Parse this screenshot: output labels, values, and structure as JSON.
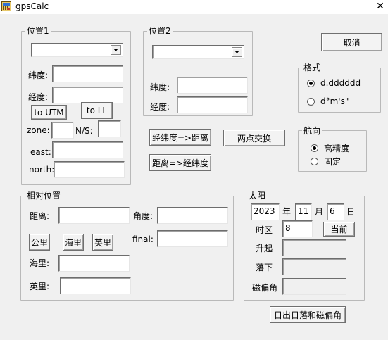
{
  "window": {
    "title": "gpsCalc",
    "close_glyph": "✕",
    "icon": "app-icon"
  },
  "pos1": {
    "legend": "位置1",
    "combo_value": "",
    "lat_label": "纬度:",
    "lat_value": "",
    "lon_label": "经度:",
    "lon_value": "",
    "to_utm_label": "to UTM",
    "to_ll_label": "to LL",
    "zone_label": "zone:",
    "zone_value": "",
    "ns_label": "N/S:",
    "ns_value": "",
    "east_label": "east:",
    "east_value": "",
    "north_label": "north:",
    "north_value": ""
  },
  "pos2": {
    "legend": "位置2",
    "combo_value": "",
    "lat_label": "纬度:",
    "lat_value": "",
    "lon_label": "经度:",
    "lon_value": ""
  },
  "actions": {
    "cancel_label": "取消",
    "ll_to_dist_label": "经纬度=>距离",
    "swap_label": "两点交换",
    "dist_to_ll_label": "距离=>经纬度",
    "sun_calc_label": "日出日落和磁偏角"
  },
  "format": {
    "legend": "格式",
    "options": [
      {
        "label": "d.dddddd",
        "selected": true
      },
      {
        "label": "d°m's\"",
        "selected": false
      }
    ]
  },
  "heading": {
    "legend": "航向",
    "options": [
      {
        "label": "高精度",
        "selected": true
      },
      {
        "label": "固定",
        "selected": false
      }
    ]
  },
  "relative": {
    "legend": "相对位置",
    "distance_label": "距离:",
    "distance_value": "",
    "angle_label": "角度:",
    "angle_value": "",
    "km_label": "公里",
    "nmi_label": "海里",
    "mile_label": "英里",
    "final_label": "final:",
    "final_value": "",
    "nmi_field_label": "海里:",
    "nmi_field_value": "",
    "mile_field_label": "英里:",
    "mile_field_value": ""
  },
  "sun": {
    "legend": "太阳",
    "year_value": "2023",
    "year_label": "年",
    "month_value": "11",
    "month_label": "月",
    "day_value": "6",
    "day_label": "日",
    "tz_label": "时区",
    "tz_value": "8",
    "now_label": "当前",
    "rise_label": "升起",
    "rise_value": "",
    "set_label": "落下",
    "set_value": "",
    "decl_label": "磁偏角",
    "decl_value": ""
  }
}
